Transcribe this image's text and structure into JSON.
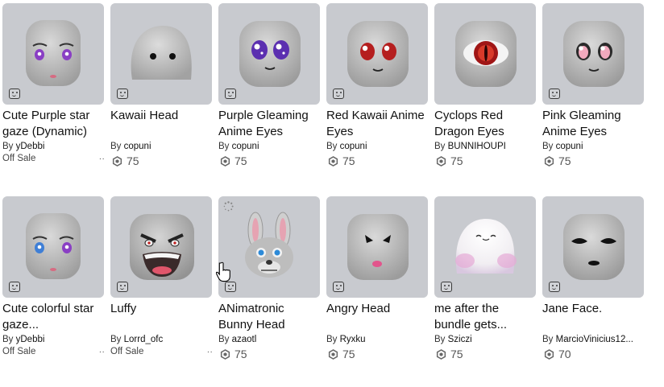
{
  "items": [
    {
      "name": "Cute Purple star gaze (Dynamic)",
      "by": "By",
      "creator": "yDebbi",
      "status": "Off Sale",
      "more": "..",
      "face": "purple-star"
    },
    {
      "name": "Kawaii Head",
      "by": "By",
      "creator": "copuni",
      "price": "75",
      "face": "kawaii"
    },
    {
      "name": "Purple Gleaming Anime Eyes",
      "by": "By",
      "creator": "copuni",
      "price": "75",
      "face": "purple-gleam"
    },
    {
      "name": "Red Kawaii Anime Eyes",
      "by": "By",
      "creator": "copuni",
      "price": "75",
      "face": "red-kawaii"
    },
    {
      "name": "Cyclops Red Dragon Eyes",
      "by": "By",
      "creator": "BUNNIHOUPI",
      "price": "75",
      "face": "cyclops"
    },
    {
      "name": "Pink Gleaming Anime Eyes",
      "by": "By",
      "creator": "copuni",
      "price": "75",
      "face": "pink-gleam"
    },
    {
      "name": "Cute colorful star gaze...",
      "by": "By",
      "creator": "yDebbi",
      "status": "Off Sale",
      "more": "..",
      "face": "colorful-star"
    },
    {
      "name": "Luffy",
      "by": "By",
      "creator": "Lorrd_ofc",
      "status": "Off Sale",
      "more": "..",
      "face": "luffy"
    },
    {
      "name": "ANimatronic Bunny Head",
      "by": "By",
      "creator": "azaotl",
      "price": "75",
      "face": "bunny"
    },
    {
      "name": "Angry Head",
      "by": "By",
      "creator": "Ryxku",
      "price": "75",
      "face": "angry"
    },
    {
      "name": "me after the bundle gets...",
      "by": "By",
      "creator": "Sziczi",
      "price": "75",
      "face": "marshmallow"
    },
    {
      "name": "Jane Face.",
      "by": "By",
      "creator": "MarcioVinicius12...",
      "price": "70",
      "face": "jane"
    }
  ]
}
